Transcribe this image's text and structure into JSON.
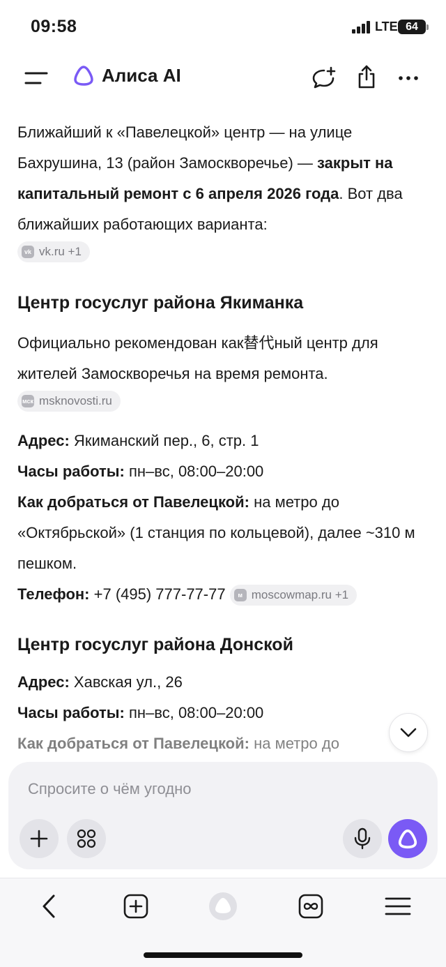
{
  "status_bar": {
    "time": "09:58",
    "network": "LTE",
    "battery": "64"
  },
  "header": {
    "title": "Алиса AI",
    "icons": [
      "menu-icon",
      "alisa-logo-icon",
      "new-chat-icon",
      "share-icon",
      "more-icon"
    ]
  },
  "intro": {
    "part1": "Ближайший к «Павелецкой» центр — на улице Бахрушина, 13 (район Замоскворечье) — ",
    "bold": "закрыт на капитальный ремонт с 6 апреля 2026 года",
    "part2": ". Вот два ближайших работающих варианта:",
    "source": "vk.ru +1"
  },
  "centers": [
    {
      "title": "Центр госуслуг района Якиманка",
      "description": "Официально рекомендован как替代ный центр для жителей Замоскворечья на время ремонта.",
      "description_source": "msknovosti.ru",
      "address_label": "Адрес:",
      "address": " Якиманский пер., 6, стр. 1",
      "hours_label": "Часы работы:",
      "hours": " пн–вс, 08:00–20:00",
      "route_label": "Как добраться от Павелецкой:",
      "route": " на метро до «Октябрьской» (1 станция по кольцевой), далее ~310 м пешком.",
      "phone_label": "Телефон:",
      "phone": " +7 (495) 777-77-77",
      "phone_source": "moscowmap.ru +1"
    },
    {
      "title": "Центр госуслуг района Донской",
      "address_label": "Адрес:",
      "address": " Хавская ул., 26",
      "hours_label": "Часы работы:",
      "hours": " пн–вс, 08:00–20:00",
      "route_label": "Как добраться от Павелецкой:",
      "route": " на метро до"
    }
  ],
  "composer": {
    "placeholder": "Спросите о чём угодно"
  },
  "colors": {
    "accent": "#7a5af5",
    "text": "#1a1a1a",
    "chip_bg": "#f0f0f2",
    "composer_bg": "#f2f2f5"
  }
}
